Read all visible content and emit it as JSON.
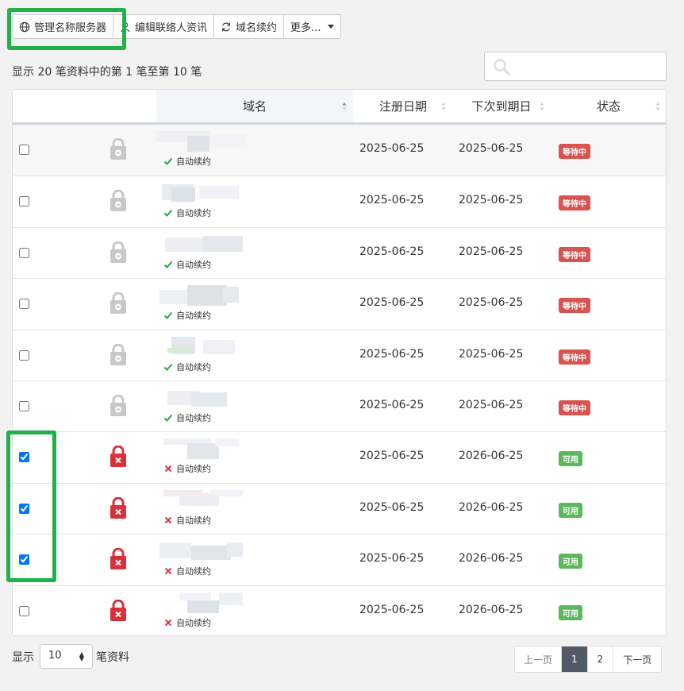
{
  "toolbar": {
    "manage_ns": "管理名称服务器",
    "edit_contact": "编辑联络人资讯",
    "renew": "域名续约",
    "more": "更多..."
  },
  "info_text": "显示 20 笔资料中的第 1 笔至第 10 笔",
  "search": {
    "placeholder": ""
  },
  "table": {
    "headers": {
      "domain": "域名",
      "reg_date": "注册日期",
      "exp_date": "下次到期日",
      "status": "状态"
    },
    "auto_renew_label": "自动续约",
    "rows": [
      {
        "checked": false,
        "lock": "gray",
        "auto_renew": true,
        "reg_date": "2025-06-25",
        "exp_date": "2025-06-25",
        "status": "等待中",
        "status_type": "pending"
      },
      {
        "checked": false,
        "lock": "gray",
        "auto_renew": true,
        "reg_date": "2025-06-25",
        "exp_date": "2025-06-25",
        "status": "等待中",
        "status_type": "pending"
      },
      {
        "checked": false,
        "lock": "gray",
        "auto_renew": true,
        "reg_date": "2025-06-25",
        "exp_date": "2025-06-25",
        "status": "等待中",
        "status_type": "pending"
      },
      {
        "checked": false,
        "lock": "gray",
        "auto_renew": true,
        "reg_date": "2025-06-25",
        "exp_date": "2025-06-25",
        "status": "等待中",
        "status_type": "pending"
      },
      {
        "checked": false,
        "lock": "gray",
        "auto_renew": true,
        "reg_date": "2025-06-25",
        "exp_date": "2025-06-25",
        "status": "等待中",
        "status_type": "pending"
      },
      {
        "checked": false,
        "lock": "gray",
        "auto_renew": true,
        "reg_date": "2025-06-25",
        "exp_date": "2025-06-25",
        "status": "等待中",
        "status_type": "pending"
      },
      {
        "checked": true,
        "lock": "red",
        "auto_renew": false,
        "reg_date": "2025-06-25",
        "exp_date": "2026-06-25",
        "status": "可用",
        "status_type": "active"
      },
      {
        "checked": true,
        "lock": "red",
        "auto_renew": false,
        "reg_date": "2025-06-25",
        "exp_date": "2026-06-25",
        "status": "可用",
        "status_type": "active"
      },
      {
        "checked": true,
        "lock": "red",
        "auto_renew": false,
        "reg_date": "2025-06-25",
        "exp_date": "2026-06-25",
        "status": "可用",
        "status_type": "active"
      },
      {
        "checked": false,
        "lock": "red",
        "auto_renew": false,
        "reg_date": "2025-06-25",
        "exp_date": "2026-06-25",
        "status": "可用",
        "status_type": "active"
      }
    ]
  },
  "footer": {
    "show_label": "显示",
    "page_size": "10",
    "records_label": "笔资料"
  },
  "pagination": {
    "prev": "上一页",
    "pages": [
      "1",
      "2"
    ],
    "current": "1",
    "next": "下一页"
  },
  "colors": {
    "highlight": "#22b04b",
    "pending_badge": "#d9534f",
    "active_badge": "#5cb85c",
    "lock_red": "#d9303a",
    "lock_gray": "#c8c8c8",
    "check_green": "#28a745",
    "cross_red": "#dc3545"
  }
}
